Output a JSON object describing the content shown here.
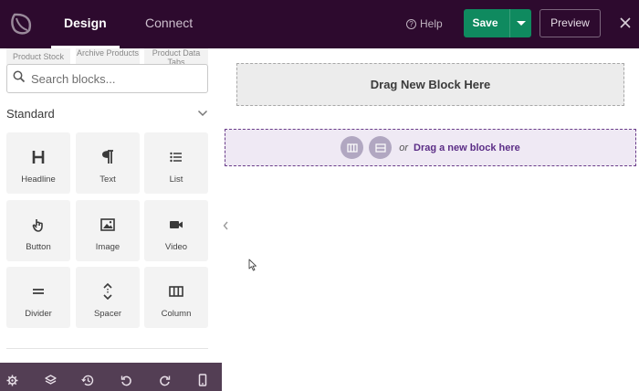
{
  "topbar": {
    "logo": "leaf-logo-icon",
    "tabs": [
      {
        "label": "Design",
        "active": true
      },
      {
        "label": "Connect",
        "active": false
      }
    ],
    "help_label": "Help",
    "save_label": "Save",
    "preview_label": "Preview"
  },
  "sidebar": {
    "peek_tiles": [
      "Product Stock",
      "Archive Products",
      "Product Data Tabs"
    ],
    "search_placeholder": "Search blocks...",
    "section_title": "Standard",
    "blocks": [
      {
        "label": "Headline",
        "icon": "headline-icon"
      },
      {
        "label": "Text",
        "icon": "paragraph-icon"
      },
      {
        "label": "List",
        "icon": "list-icon"
      },
      {
        "label": "Button",
        "icon": "pointer-hand-icon"
      },
      {
        "label": "Image",
        "icon": "image-icon"
      },
      {
        "label": "Video",
        "icon": "video-camera-icon"
      },
      {
        "label": "Divider",
        "icon": "divider-icon"
      },
      {
        "label": "Spacer",
        "icon": "spacer-icon"
      },
      {
        "label": "Column",
        "icon": "columns-icon"
      }
    ],
    "bottom_icons": [
      "gear-icon",
      "layers-icon",
      "history-icon",
      "undo-icon",
      "redo-icon",
      "mobile-icon"
    ]
  },
  "canvas": {
    "drop_zone_label": "Drag New Block Here",
    "or_text": "or",
    "add_block_label": "Drag a new block here"
  },
  "colors": {
    "topbar_bg": "#2d0a2e",
    "save_green": "#0f8a5f",
    "accent_purple": "#5b2d86",
    "bottombar_bg": "#533e54"
  }
}
